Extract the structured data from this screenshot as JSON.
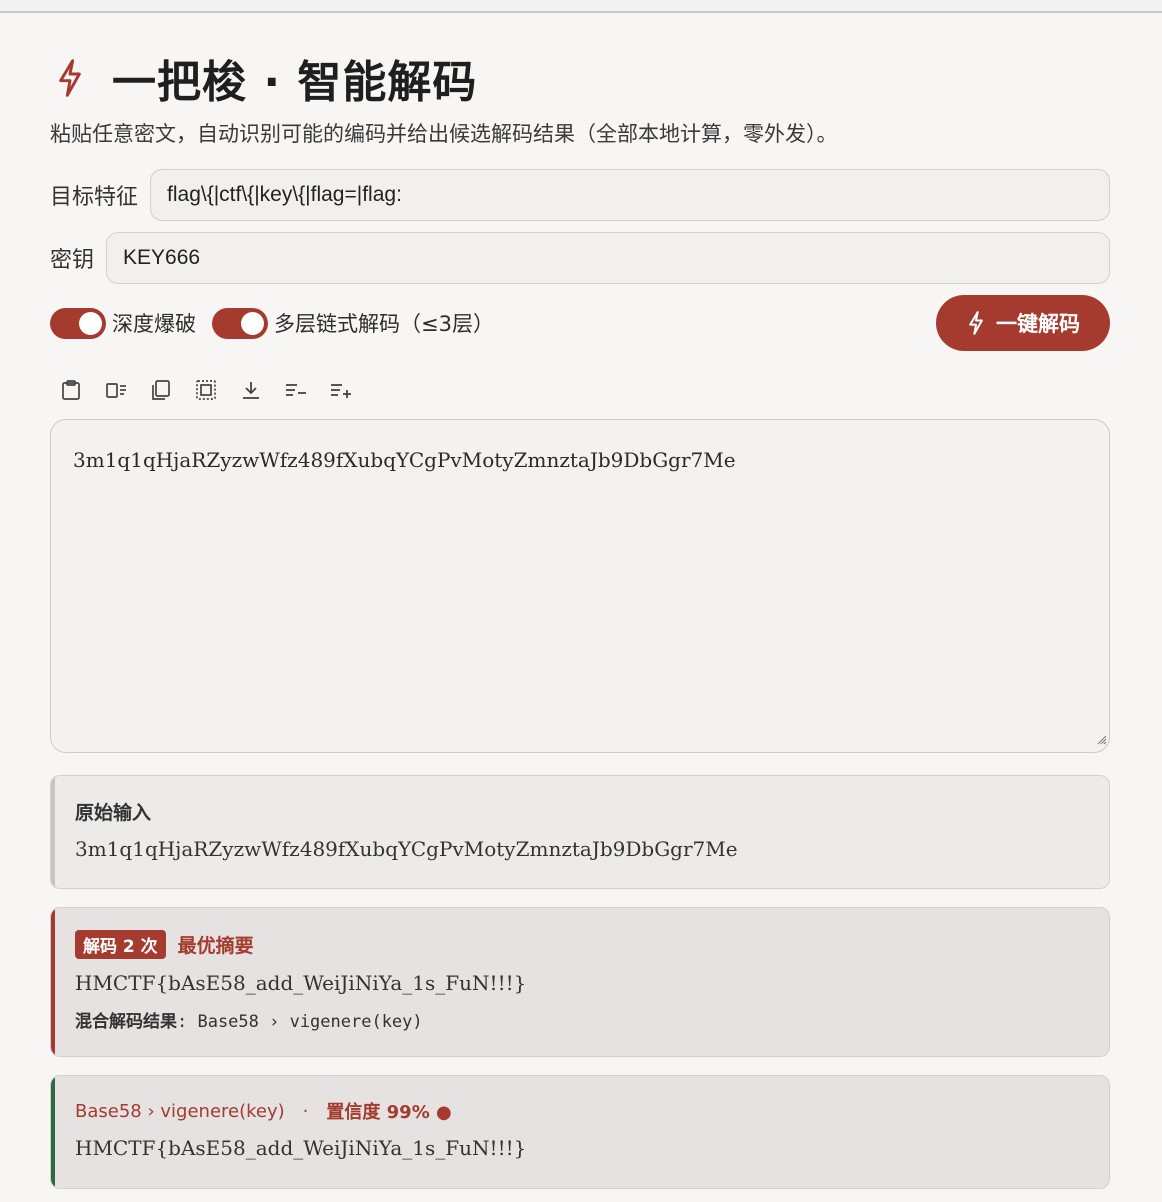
{
  "app": {
    "title": "一把梭 · 智能解码",
    "subtitle": "粘贴任意密文，自动识别可能的编码并给出候选解码结果（全部本地计算，零外发）。"
  },
  "fields": {
    "pattern_label": "目标特征",
    "pattern_value": "flag\\{|ctf\\{|key\\{|flag=|flag:",
    "key_label": "密钥",
    "key_value": "KEY666"
  },
  "options": {
    "deep_brute_label": "深度爆破",
    "deep_brute_on": true,
    "multilayer_label": "多层链式解码（≤3层）",
    "multilayer_on": true,
    "decode_button": "一键解码"
  },
  "toolbar": {
    "icons": [
      "clipboard-icon",
      "clear-format-icon",
      "copy-icon",
      "select-all-icon",
      "download-icon",
      "decrease-lines-icon",
      "increase-lines-icon"
    ]
  },
  "input": {
    "text": "3m1q1qHjaRZyzwWfz489fXubqYCgPvMotyZmnztaJb9DbGgr7Me"
  },
  "results": {
    "original": {
      "title": "原始输入",
      "text": "3m1q1qHjaRZyzwWfz489fXubqYCgPvMotyZmnztaJb9DbGgr7Me"
    },
    "best": {
      "badge": "解码 2 次",
      "label": "最优摘要",
      "text": "HMCTF{bAsE58_add_WeiJiNiYa_1s_FuN!!!}",
      "chain_key": "混合解码结果",
      "chain_value": ": Base58 › vigenere(key)"
    },
    "candidate": {
      "chain": "Base58 › vigenere(key)",
      "separator": "·",
      "confidence": "置信度 99% ●",
      "text": "HMCTF{bAsE58_add_WeiJiNiYa_1s_FuN!!!}"
    }
  },
  "colors": {
    "accent": "#a43b2e",
    "success_border": "#2e6b3f",
    "background": "#f7f6f5"
  }
}
